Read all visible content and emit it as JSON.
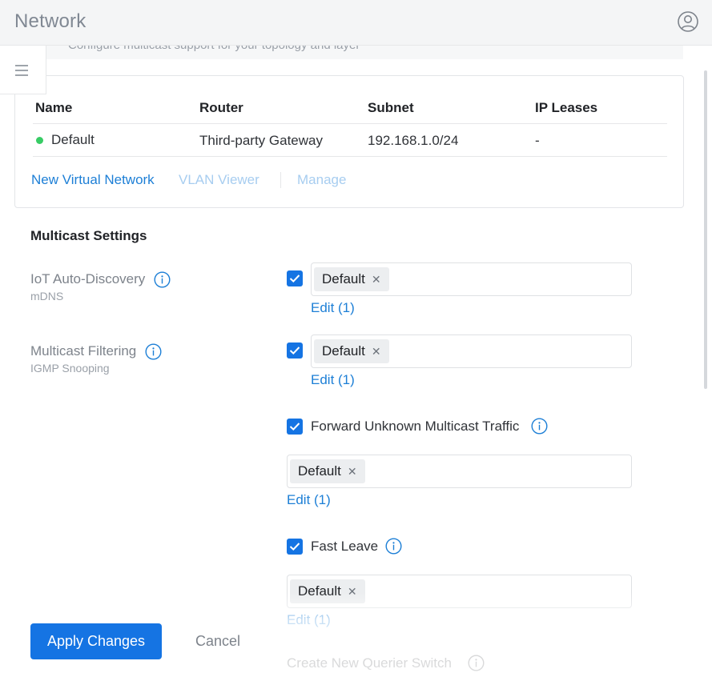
{
  "header": {
    "title": "Network"
  },
  "description_fragment": "Configure multicast support for your topology and layer",
  "network_table": {
    "columns": [
      "Name",
      "Router",
      "Subnet",
      "IP Leases"
    ],
    "rows": [
      {
        "name": "Default",
        "router": "Third-party Gateway",
        "subnet": "192.168.1.0/24",
        "ip_leases": "-",
        "status_color": "#38cc65"
      }
    ],
    "links": {
      "new_network": "New Virtual Network",
      "vlan_viewer": "VLAN Viewer",
      "manage": "Manage"
    }
  },
  "multicast": {
    "title": "Multicast Settings",
    "iot": {
      "label": "IoT Auto-Discovery",
      "sub": "mDNS",
      "checked": true,
      "tag": "Default",
      "edit": "Edit (1)"
    },
    "filtering": {
      "label": "Multicast Filtering",
      "sub": "IGMP Snooping",
      "checked": true,
      "tag": "Default",
      "edit": "Edit (1)"
    },
    "forward_unknown": {
      "label": "Forward Unknown Multicast Traffic",
      "checked": true,
      "tag": "Default",
      "edit": "Edit (1)"
    },
    "fast_leave": {
      "label": "Fast Leave",
      "checked": true,
      "tag": "Default",
      "edit": "Edit (1)"
    },
    "querier": {
      "label": "Create New Querier Switch"
    }
  },
  "footer": {
    "apply": "Apply Changes",
    "cancel": "Cancel"
  },
  "colors": {
    "primary": "#1574e3",
    "link": "#1d7fd6",
    "online": "#38cc65"
  }
}
